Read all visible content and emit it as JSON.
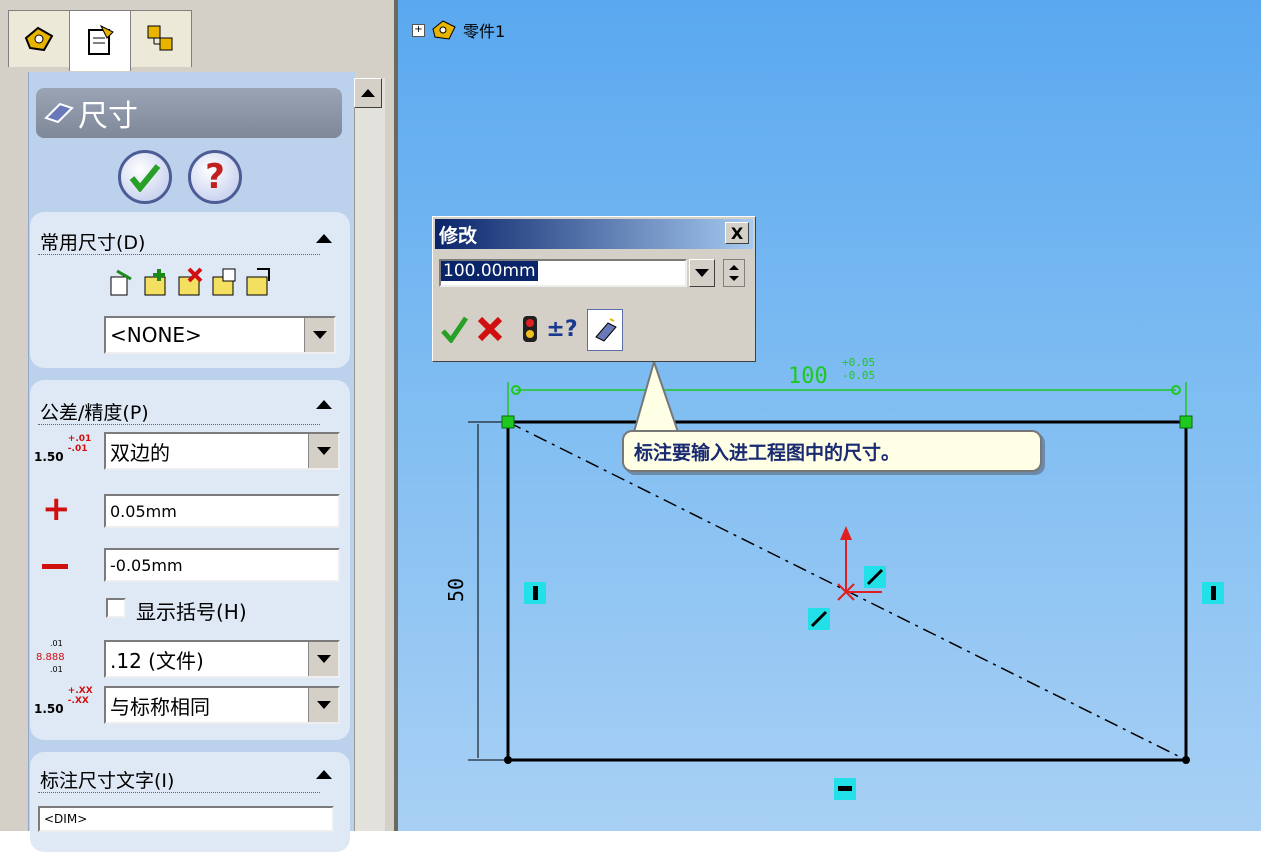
{
  "tree": {
    "part_name": "零件1"
  },
  "panel": {
    "title": "尺寸",
    "groups": {
      "common": {
        "label": "常用尺寸(D)",
        "style_value": "<NONE>"
      },
      "tolerance": {
        "label": "公差/精度(P)",
        "tolerance_type": "双边的",
        "plus_value": "0.05mm",
        "minus_value": "-0.05mm",
        "show_brackets_label": "显示括号(H)",
        "show_brackets_checked": false,
        "primary_precision": ".12 (文件)",
        "tolerance_precision": "与标称相同",
        "icon_tol_text": "1.50",
        "icon_tol_plus": "+.01",
        "icon_tol_minus": "-.01",
        "icon_prec_text": "1.50",
        "icon_prec_plus": "+.XX",
        "icon_prec_minus": "-.XX"
      },
      "dim_text": {
        "label": "标注尺寸文字(I)",
        "value": "<DIM>"
      }
    }
  },
  "modify_dialog": {
    "title": "修改",
    "value": "100.00mm",
    "close_label": "X"
  },
  "callout": {
    "text": "标注要输入进工程图中的尺寸。"
  },
  "sketch": {
    "horizontal_dim": "100",
    "horizontal_tol_plus": "+0.05",
    "horizontal_tol_minus": "-0.05",
    "vertical_dim": "50"
  },
  "colors": {
    "sketch_line": "#000000",
    "dimension_green": "#1fc81f",
    "relation_cyan": "#22e0e8",
    "origin_red": "#e02020",
    "highlight_red": "#e01818"
  }
}
